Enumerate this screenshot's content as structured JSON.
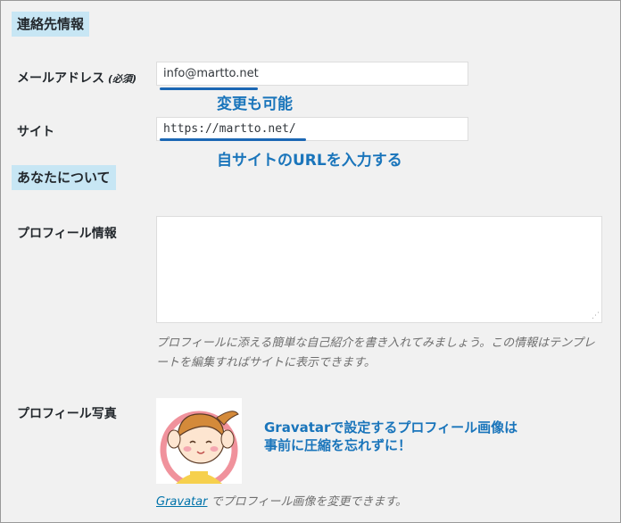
{
  "contact": {
    "heading": "連絡先情報",
    "email_label": "メールアドレス",
    "email_required": "(必須)",
    "email_value": "info@martto.net",
    "email_annotation": "変更も可能",
    "site_label": "サイト",
    "site_value": "https://martto.net/",
    "site_annotation": "自サイトのURLを入力する"
  },
  "about": {
    "heading": "あなたについて",
    "bio_label": "プロフィール情報",
    "bio_value": "",
    "bio_description": "プロフィールに添える簡単な自己紹介を書き入れてみましょう。この情報はテンプレートを編集すればサイトに表示できます。",
    "picture_label": "プロフィール写真",
    "picture_annotation_line1": "Gravatarで設定するプロフィール画像は",
    "picture_annotation_line2": "事前に圧縮を忘れずに！",
    "gravatar_link": "Gravatar",
    "gravatar_text": " でプロフィール画像を変更できます。"
  },
  "colors": {
    "heading_bg": "#c7e6f4",
    "annotation": "#1a75bb",
    "underline": "#1b67b4"
  }
}
